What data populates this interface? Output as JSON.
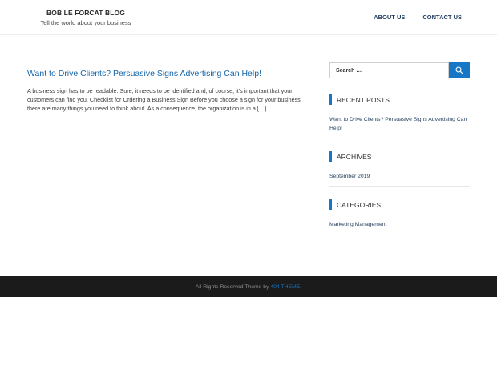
{
  "header": {
    "site_title": "BOB LE FORCAT BLOG",
    "site_description": "Tell the world about your business",
    "nav": [
      {
        "label": "ABOUT US"
      },
      {
        "label": "CONTACT US"
      }
    ]
  },
  "main": {
    "post_title": "Want to Drive Clients? Persuasive Signs Advertising Can Help!",
    "post_excerpt": "A business sign has to be readable. Sure, it needs to be identified and, of course, it's important that your customers can find you. Checklist for Ordering a Business Sign Before you choose a sign for your business there are many things you need to think about. As a consequence, the organization is in a […]"
  },
  "sidebar": {
    "search": {
      "placeholder": "Search …",
      "icon": "search-icon"
    },
    "recent_posts": {
      "title": "RECENT POSTS",
      "items": [
        {
          "label": "Want to Drive Clients? Persuasive Signs Advertising Can Help!"
        }
      ]
    },
    "archives": {
      "title": "ARCHIVES",
      "items": [
        {
          "label": "September 2019"
        }
      ]
    },
    "categories": {
      "title": "CATEGORIES",
      "items": [
        {
          "label": "Marketing Management"
        }
      ]
    }
  },
  "footer": {
    "text_prefix": "All Rights Reserved Theme by ",
    "link_label": "404 THEME",
    "text_suffix": "."
  },
  "colors": {
    "accent": "#1577c6",
    "title_link": "#1565a8",
    "footer_bg": "#1b1b1b"
  }
}
